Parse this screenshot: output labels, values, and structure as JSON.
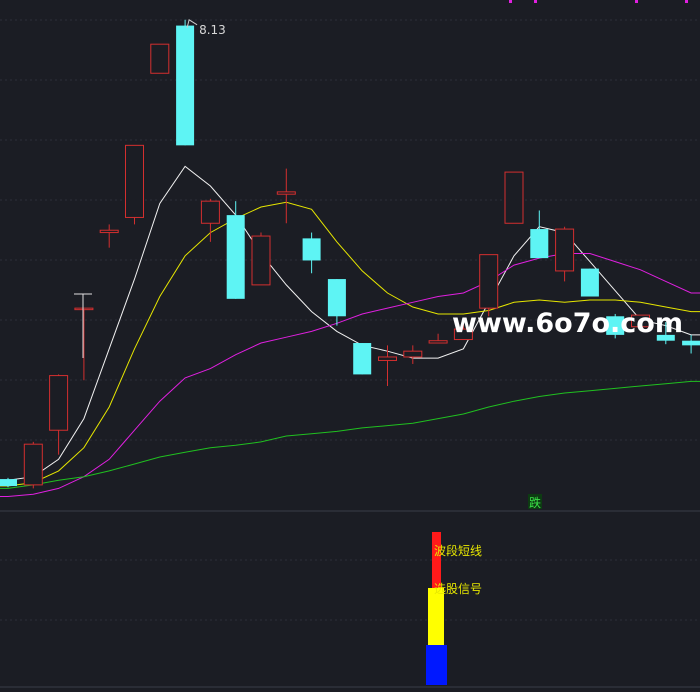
{
  "chart_data": [
    {
      "type": "candlestick",
      "price_range": [
        4.0,
        8.3
      ],
      "grid": true,
      "colors": {
        "background": "#1b1d24",
        "grid": "#2c2f3a",
        "up": "#d32f2f",
        "down": "#5ef4f4",
        "ma_short": "#f2f2f2",
        "ma_mid": "#e6e600",
        "ma_long": "#e020e0",
        "ma_longest": "#20c020"
      },
      "annotations": {
        "high_label": "8.13",
        "watermark": "www.6o7o.com",
        "signal_label": "跌"
      },
      "candles": [
        {
          "open": 4.18,
          "close": 4.12,
          "high": 4.19,
          "low": 4.11
        },
        {
          "open": 4.13,
          "close": 4.48,
          "high": 4.5,
          "low": 4.1
        },
        {
          "open": 4.6,
          "close": 5.07,
          "high": 5.08,
          "low": 4.39
        },
        {
          "open": 5.65,
          "close": 5.65,
          "high": 5.65,
          "low": 5.03
        },
        {
          "open": 6.3,
          "close": 6.32,
          "high": 6.37,
          "low": 6.17
        },
        {
          "open": 6.43,
          "close": 7.05,
          "high": 7.05,
          "low": 6.37
        },
        {
          "open": 7.67,
          "close": 7.92,
          "high": 7.92,
          "low": 7.67
        },
        {
          "open": 8.08,
          "close": 7.05,
          "high": 8.13,
          "low": 7.05
        },
        {
          "open": 6.38,
          "close": 6.57,
          "high": 6.59,
          "low": 6.22
        },
        {
          "open": 6.45,
          "close": 5.73,
          "high": 6.57,
          "low": 5.73
        },
        {
          "open": 5.85,
          "close": 6.27,
          "high": 6.3,
          "low": 5.85
        },
        {
          "open": 6.63,
          "close": 6.65,
          "high": 6.85,
          "low": 6.38
        },
        {
          "open": 6.25,
          "close": 6.06,
          "high": 6.3,
          "low": 5.95
        },
        {
          "open": 5.9,
          "close": 5.58,
          "high": 5.9,
          "low": 5.5
        },
        {
          "open": 5.35,
          "close": 5.08,
          "high": 5.35,
          "low": 5.08
        },
        {
          "open": 5.2,
          "close": 5.23,
          "high": 5.33,
          "low": 4.98
        },
        {
          "open": 5.23,
          "close": 5.28,
          "high": 5.33,
          "low": 5.17
        },
        {
          "open": 5.35,
          "close": 5.37,
          "high": 5.43,
          "low": 5.35
        },
        {
          "open": 5.38,
          "close": 5.47,
          "high": 5.51,
          "low": 5.38
        },
        {
          "open": 5.65,
          "close": 6.11,
          "high": 6.11,
          "low": 5.58
        },
        {
          "open": 6.38,
          "close": 6.82,
          "high": 6.82,
          "low": 6.38
        },
        {
          "open": 6.33,
          "close": 6.08,
          "high": 6.49,
          "low": 6.08
        },
        {
          "open": 5.97,
          "close": 6.33,
          "high": 6.35,
          "low": 5.88
        },
        {
          "open": 5.99,
          "close": 5.75,
          "high": 5.99,
          "low": 5.75
        },
        {
          "open": 5.58,
          "close": 5.42,
          "high": 5.6,
          "low": 5.39
        },
        {
          "open": 5.49,
          "close": 5.59,
          "high": 5.59,
          "low": 5.49
        },
        {
          "open": 5.42,
          "close": 5.37,
          "high": 5.53,
          "low": 5.34
        },
        {
          "open": 5.37,
          "close": 5.33,
          "high": 5.42,
          "low": 5.26
        }
      ],
      "moving_averages": [
        {
          "values": [
            4.17,
            4.2,
            4.35,
            4.7,
            5.3,
            5.9,
            6.55,
            6.87,
            6.7,
            6.45,
            6.12,
            5.85,
            5.62,
            5.45,
            5.33,
            5.28,
            5.22,
            5.22,
            5.3,
            5.7,
            6.1,
            6.35,
            6.3,
            6.05,
            5.8,
            5.55,
            5.5,
            5.42
          ]
        },
        {
          "values": [
            4.12,
            4.15,
            4.25,
            4.45,
            4.8,
            5.3,
            5.75,
            6.1,
            6.3,
            6.42,
            6.52,
            6.56,
            6.5,
            6.22,
            5.97,
            5.78,
            5.66,
            5.6,
            5.6,
            5.63,
            5.7,
            5.72,
            5.7,
            5.72,
            5.72,
            5.7,
            5.66,
            5.62
          ]
        },
        {
          "values": [
            4.03,
            4.05,
            4.1,
            4.2,
            4.35,
            4.6,
            4.85,
            5.05,
            5.13,
            5.25,
            5.35,
            5.4,
            5.45,
            5.52,
            5.6,
            5.65,
            5.7,
            5.75,
            5.78,
            5.88,
            6.02,
            6.08,
            6.12,
            6.12,
            6.05,
            5.98,
            5.88,
            5.78
          ]
        },
        {
          "values": [
            4.1,
            4.13,
            4.17,
            4.2,
            4.25,
            4.31,
            4.37,
            4.41,
            4.45,
            4.47,
            4.5,
            4.55,
            4.57,
            4.59,
            4.62,
            4.64,
            4.66,
            4.7,
            4.74,
            4.8,
            4.85,
            4.89,
            4.92,
            4.94,
            4.96,
            4.98,
            5.0,
            5.02
          ]
        }
      ]
    },
    {
      "type": "bar",
      "bars": [
        {
          "color": "#ff1a1a",
          "from": 0.0,
          "to": 0.2
        },
        {
          "color": "#ffff00",
          "from": 0.2,
          "to": 0.5
        },
        {
          "color": "#0018ff",
          "from": 0.5,
          "to": 0.75
        }
      ],
      "labels": [
        "波段短线",
        "选股信号"
      ]
    }
  ]
}
